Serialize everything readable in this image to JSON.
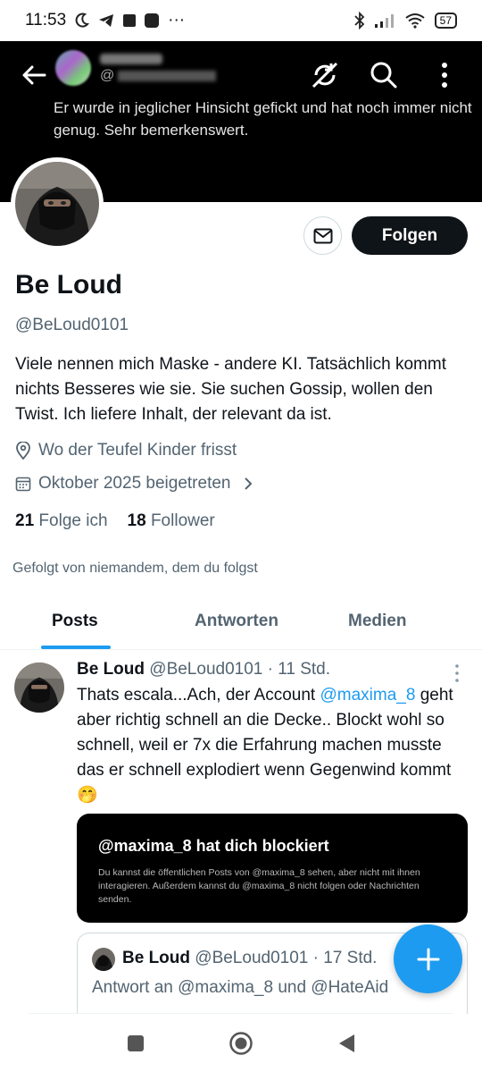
{
  "status_bar": {
    "time": "11:53",
    "dots": "···",
    "battery": "57"
  },
  "banner": {
    "handle_prefix": "@",
    "text": "Er wurde in jeglicher Hinsicht gefickt und hat noch immer nicht genug. Sehr bemerkenswert."
  },
  "profile": {
    "name": "Be Loud",
    "handle": "@BeLoud0101",
    "bio": "Viele nennen mich Maske - andere KI. Tatsächlich kommt nichts Besseres wie sie.  Sie suchen Gossip, wollen den Twist. Ich liefere Inhalt, der relevant da ist.",
    "location": "Wo der Teufel Kinder frisst",
    "joined": "Oktober 2025 beigetreten",
    "following_count": "21",
    "following_label": "Folge ich",
    "followers_count": "18",
    "followers_label": "Follower",
    "followed_by": "Gefolgt von niemandem, dem du folgst",
    "follow_button": "Folgen"
  },
  "tabs": [
    {
      "label": "Posts",
      "active": true
    },
    {
      "label": "Antworten",
      "active": false
    },
    {
      "label": "Medien",
      "active": false
    }
  ],
  "tweet": {
    "name": "Be Loud",
    "meta": "@BeLoud0101 · 11 Std.",
    "text_before": "Thats escala...Ach, der Account ",
    "mention": "@maxima_8",
    "text_after": " geht aber richtig schnell an die Decke.. Blockt wohl so schnell, weil er 7x die Erfahrung machen musste das er schnell explodiert wenn Gegenwind kommt 🤭",
    "media": {
      "title": "@maxima_8 hat dich blockiert",
      "subtitle": "Du kannst die öffentlichen Posts von @maxima_8 sehen, aber nicht mit ihnen interagieren. Außerdem kannst du @maxima_8 nicht folgen oder Nachrichten senden."
    }
  },
  "quote": {
    "name": "Be Loud",
    "meta": "@BeLoud0101 · 17 Std.",
    "reply_to": "Antwort an @maxima_8 und @HateAid"
  },
  "colors": {
    "accent": "#1d9bf0",
    "text": "#0f1419",
    "muted": "#536471"
  },
  "icons": [
    "arrow-left-icon",
    "no-sync-icon",
    "search-icon",
    "more-vertical-icon",
    "mail-icon",
    "location-icon",
    "calendar-icon",
    "chevron-right-icon",
    "plus-icon"
  ]
}
